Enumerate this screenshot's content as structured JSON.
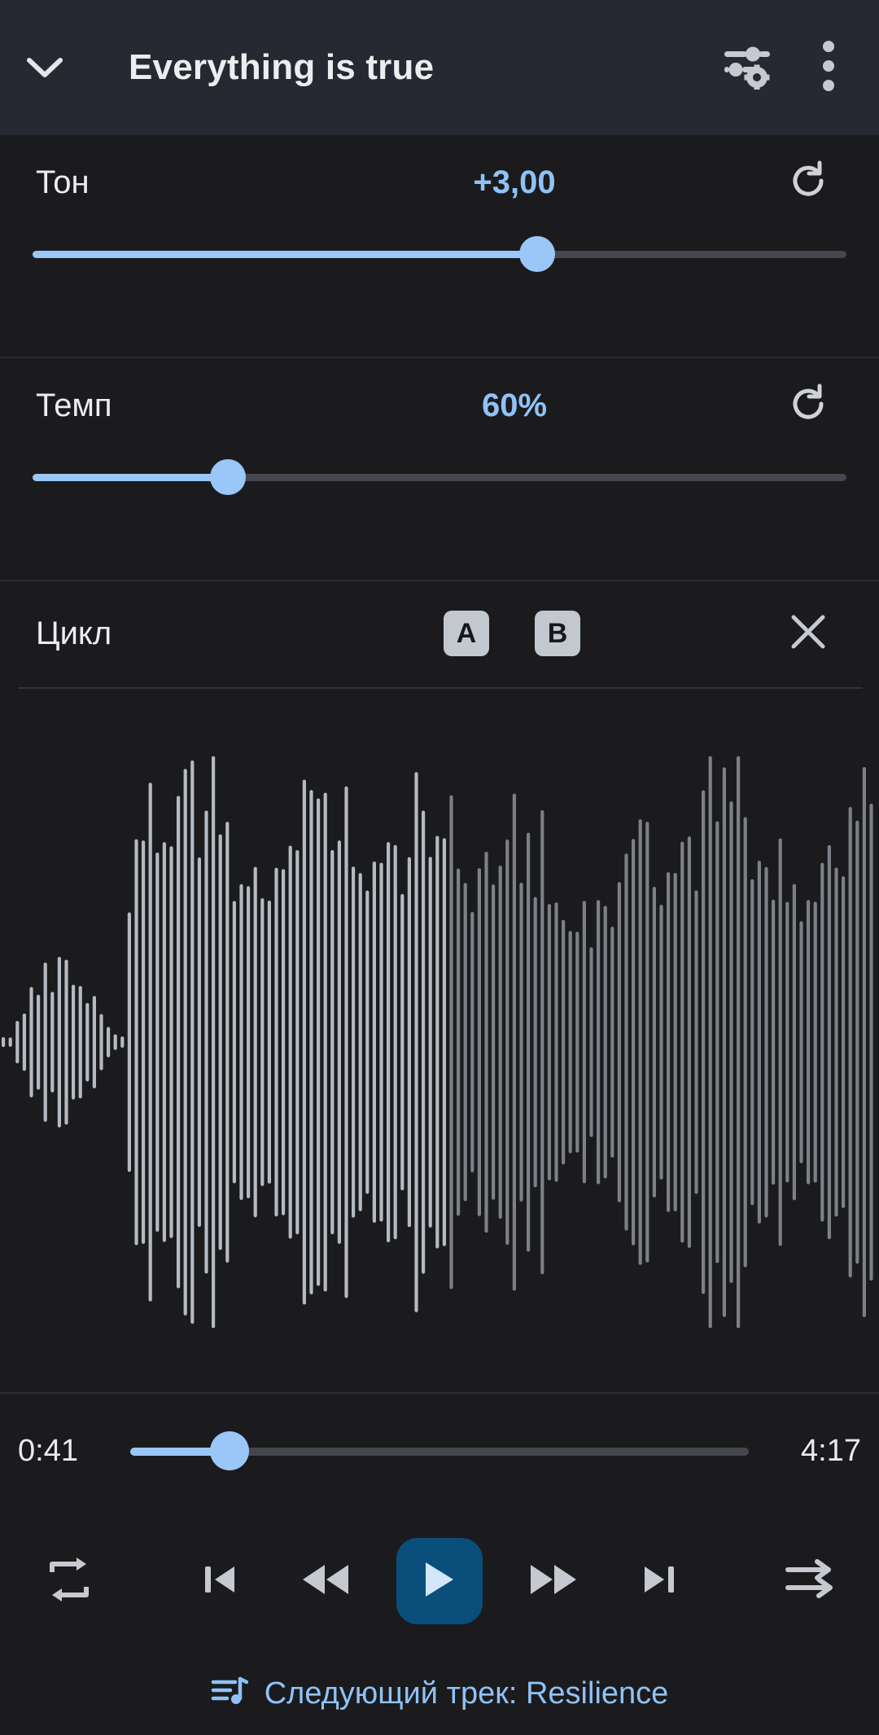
{
  "header": {
    "collapse_icon": "chevron-down-icon",
    "title": "Everything is true",
    "equalizer_icon": "equalizer-settings-icon",
    "overflow_icon": "kebab-menu-icon"
  },
  "controls": {
    "pitch": {
      "label": "Тон",
      "value": "+3,00",
      "reset_icon": "reset-icon",
      "slider_percent": 62
    },
    "tempo": {
      "label": "Темп",
      "value": "60%",
      "reset_icon": "reset-icon",
      "slider_percent": 24
    },
    "loop": {
      "label": "Цикл",
      "marker_a": "A",
      "marker_b": "B",
      "close_icon": "close-icon"
    }
  },
  "waveform": {
    "progress_percent": 50.5,
    "played_color": "#b4bac1",
    "unplayed_color": "#7c8187"
  },
  "seek": {
    "current_time": "0:41",
    "total_time": "4:17",
    "progress_percent": 16
  },
  "transport": {
    "repeat_icon": "repeat-icon",
    "previous_icon": "skip-previous-icon",
    "rewind_icon": "rewind-icon",
    "play_icon": "play-icon",
    "forward_icon": "fast-forward-icon",
    "next_icon": "skip-next-icon",
    "shuffle_icon": "shuffle-icon",
    "play_button_color": "#0a4e7c",
    "play_glyph_color": "#d4e6fa"
  },
  "next_track": {
    "queue_icon": "queue-music-icon",
    "label": "Следующий трек: Resilience",
    "color": "#8fc2f7"
  },
  "colors": {
    "accent_blue": "#8fc2f7",
    "slider_blue": "#9ac6f8",
    "header_bg": "#262931",
    "body_bg": "#1b1b1d",
    "text_primary": "#ebedef"
  }
}
